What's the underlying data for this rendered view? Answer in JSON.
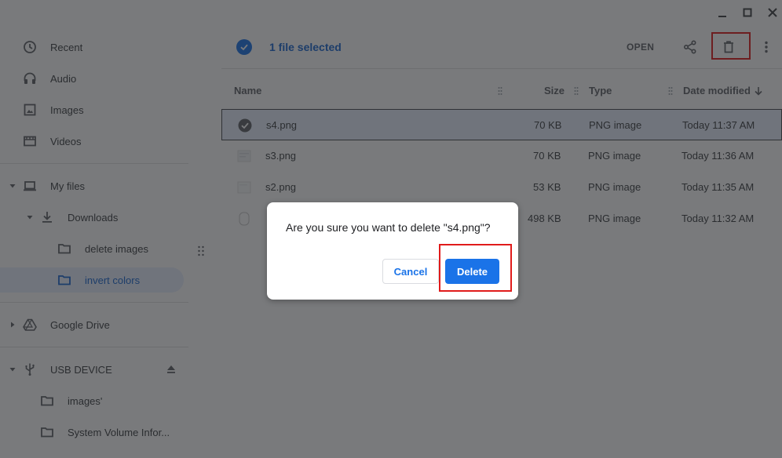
{
  "window": {
    "minimize_icon": "minimize-icon",
    "maximize_icon": "maximize-icon",
    "close_icon": "close-icon"
  },
  "sidebar": {
    "recent": "Recent",
    "audio": "Audio",
    "images": "Images",
    "videos": "Videos",
    "my_files": "My files",
    "downloads": "Downloads",
    "delete_images": "delete images",
    "invert_colors": "invert colors",
    "google_drive": "Google Drive",
    "usb_device": "USB DEVICE",
    "usb_images": "images'",
    "system_volume": "System Volume Infor..."
  },
  "toolbar": {
    "selection_text": "1 file selected",
    "open_label": "OPEN"
  },
  "columns": {
    "name": "Name",
    "size": "Size",
    "type": "Type",
    "date_modified": "Date modified"
  },
  "files": [
    {
      "name": "s4.png",
      "size": "70 KB",
      "type": "PNG image",
      "date": "Today 11:37 AM"
    },
    {
      "name": "s3.png",
      "size": "70 KB",
      "type": "PNG image",
      "date": "Today 11:36 AM"
    },
    {
      "name": "s2.png",
      "size": "53 KB",
      "type": "PNG image",
      "date": "Today 11:35 AM"
    },
    {
      "name": "",
      "size": "498 KB",
      "type": "PNG image",
      "date": "Today 11:32 AM"
    }
  ],
  "dialog": {
    "message": "Are you sure you want to delete \"s4.png\"?",
    "cancel_label": "Cancel",
    "delete_label": "Delete"
  },
  "colors": {
    "accent": "#1a73e8",
    "highlight": "#e01b1b",
    "scrim": "rgba(32,33,36,0.6)"
  }
}
